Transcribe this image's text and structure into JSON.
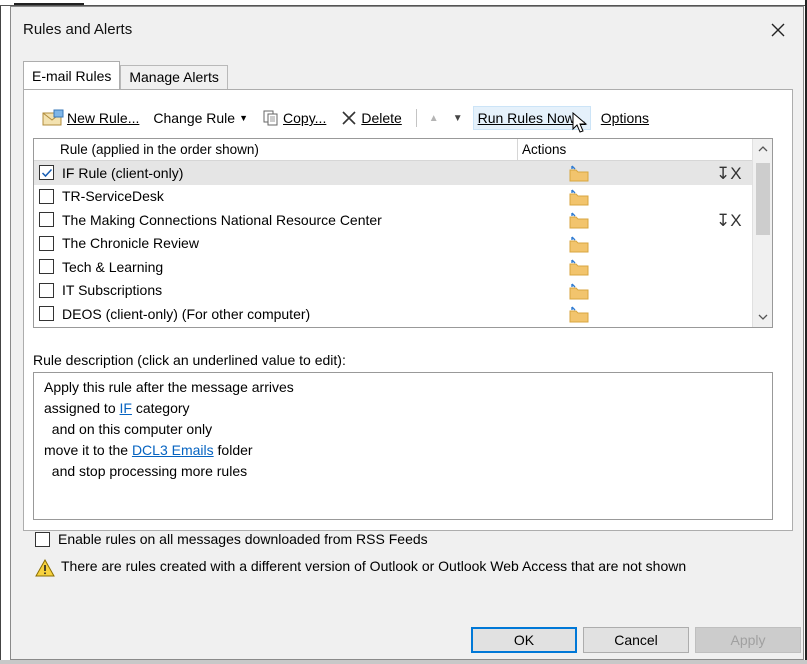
{
  "dialog": {
    "title": "Rules and Alerts",
    "close_icon": "close-icon"
  },
  "tabs": [
    {
      "label": "E-mail Rules",
      "active": true
    },
    {
      "label": "Manage Alerts",
      "active": false
    }
  ],
  "toolbar": {
    "new_rule": "New Rule...",
    "change_rule": "Change Rule",
    "copy": "Copy...",
    "delete": "Delete",
    "run_rules_now": "Run Rules Now...",
    "options": "Options"
  },
  "rules_list": {
    "header_rule": "Rule (applied in the order shown)",
    "header_actions": "Actions",
    "rows": [
      {
        "label": "IF Rule  (client-only)",
        "checked": true,
        "selected": true,
        "action_icon": true
      },
      {
        "label": "TR-ServiceDesk",
        "checked": false,
        "selected": false,
        "action_icon": false
      },
      {
        "label": "The Making Connections National Resource Center",
        "checked": false,
        "selected": false,
        "action_icon": true
      },
      {
        "label": "The Chronicle Review",
        "checked": false,
        "selected": false,
        "action_icon": false
      },
      {
        "label": "Tech & Learning",
        "checked": false,
        "selected": false,
        "action_icon": false
      },
      {
        "label": "IT Subscriptions",
        "checked": false,
        "selected": false,
        "action_icon": false
      },
      {
        "label": "DEOS  (client-only)  (For other computer)",
        "checked": false,
        "selected": false,
        "action_icon": false
      }
    ]
  },
  "description": {
    "label": "Rule description (click an underlined value to edit):",
    "line1": "Apply this rule after the message arrives",
    "line2_pre": "assigned to ",
    "line2_link": "IF",
    "line2_post": " category",
    "line3": "  and on this computer only",
    "line4_pre": "move it to the ",
    "line4_link": "DCL3 Emails",
    "line4_post": " folder",
    "line5": "  and stop processing more rules"
  },
  "rss": {
    "label": "Enable rules on all messages downloaded from RSS Feeds",
    "checked": false
  },
  "warning": {
    "text": "There are rules created with a different version of Outlook or Outlook Web Access that are not shown"
  },
  "buttons": {
    "ok": "OK",
    "cancel": "Cancel",
    "apply": "Apply"
  },
  "colors": {
    "link": "#0563c1",
    "default_button_border": "#0078d7",
    "selection": "#e5e5e5"
  }
}
